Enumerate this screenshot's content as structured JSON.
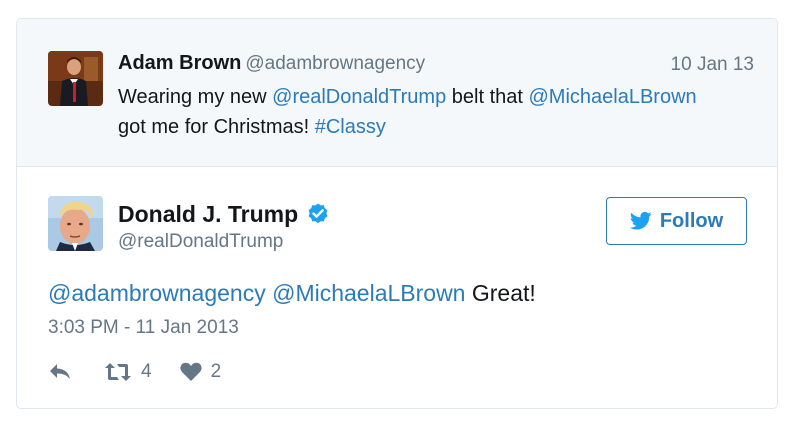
{
  "parent_tweet": {
    "author_name": "Adam Brown",
    "author_handle": "@adambrownagency",
    "date": "10 Jan 13",
    "text": {
      "prefix": "Wearing my new ",
      "mention1": "@realDonaldTrump",
      "middle": " belt that ",
      "mention2": "@MichaelaLBrown",
      "line2": " got me for Christmas! ",
      "hashtag": "#Classy"
    },
    "avatar_icon": "person-photo-avatar"
  },
  "main_tweet": {
    "author_name": "Donald J. Trump",
    "author_handle": "@realDonaldTrump",
    "verified_icon": "verified-badge-icon",
    "follow_label": "Follow",
    "follow_icon": "twitter-bird-icon",
    "text": {
      "mention1": "@adambrownagency",
      "mention2": "@MichaelaLBrown",
      "suffix": " Great!"
    },
    "timestamp": "3:03 PM - 11 Jan 2013",
    "actions": {
      "reply_icon": "reply-icon",
      "retweet_icon": "retweet-icon",
      "retweet_count": "4",
      "like_icon": "heart-icon",
      "like_count": "2"
    }
  },
  "colors": {
    "link": "#2b7bb9",
    "muted": "#657786",
    "text": "#14171a",
    "parent_bg": "#f5f8fa",
    "border": "#e1e8ed",
    "verified": "#1da1f2"
  }
}
